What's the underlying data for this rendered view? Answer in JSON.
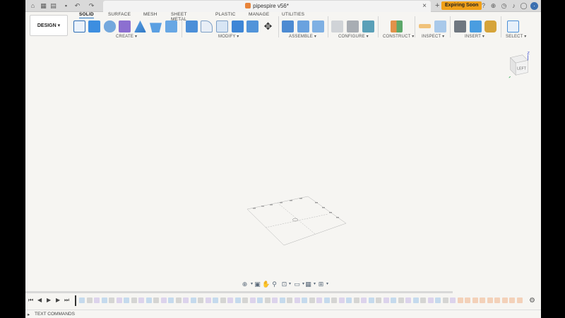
{
  "document": {
    "title": "pipespire v56*",
    "expiring_label": "Expiring Soon"
  },
  "workspace_tabs": [
    "SOLID",
    "SURFACE",
    "MESH",
    "SHEET METAL",
    "PLASTIC",
    "MANAGE",
    "UTILITIES"
  ],
  "design_button": "DESIGN",
  "toolbar_groups": {
    "create": "CREATE",
    "modify": "MODIFY",
    "assemble": "ASSEMBLE",
    "configure": "CONFIGURE",
    "construct": "CONSTRUCT",
    "inspect": "INSPECT",
    "insert": "INSERT",
    "select": "SELECT"
  },
  "viewcube": {
    "face": "LEFT",
    "axis": "Z"
  },
  "text_commands": "TEXT COMMANDS",
  "colors": {
    "accent": "#2d7bc4",
    "expiring": "#f0a018",
    "doc_icon": "#e8843a"
  }
}
